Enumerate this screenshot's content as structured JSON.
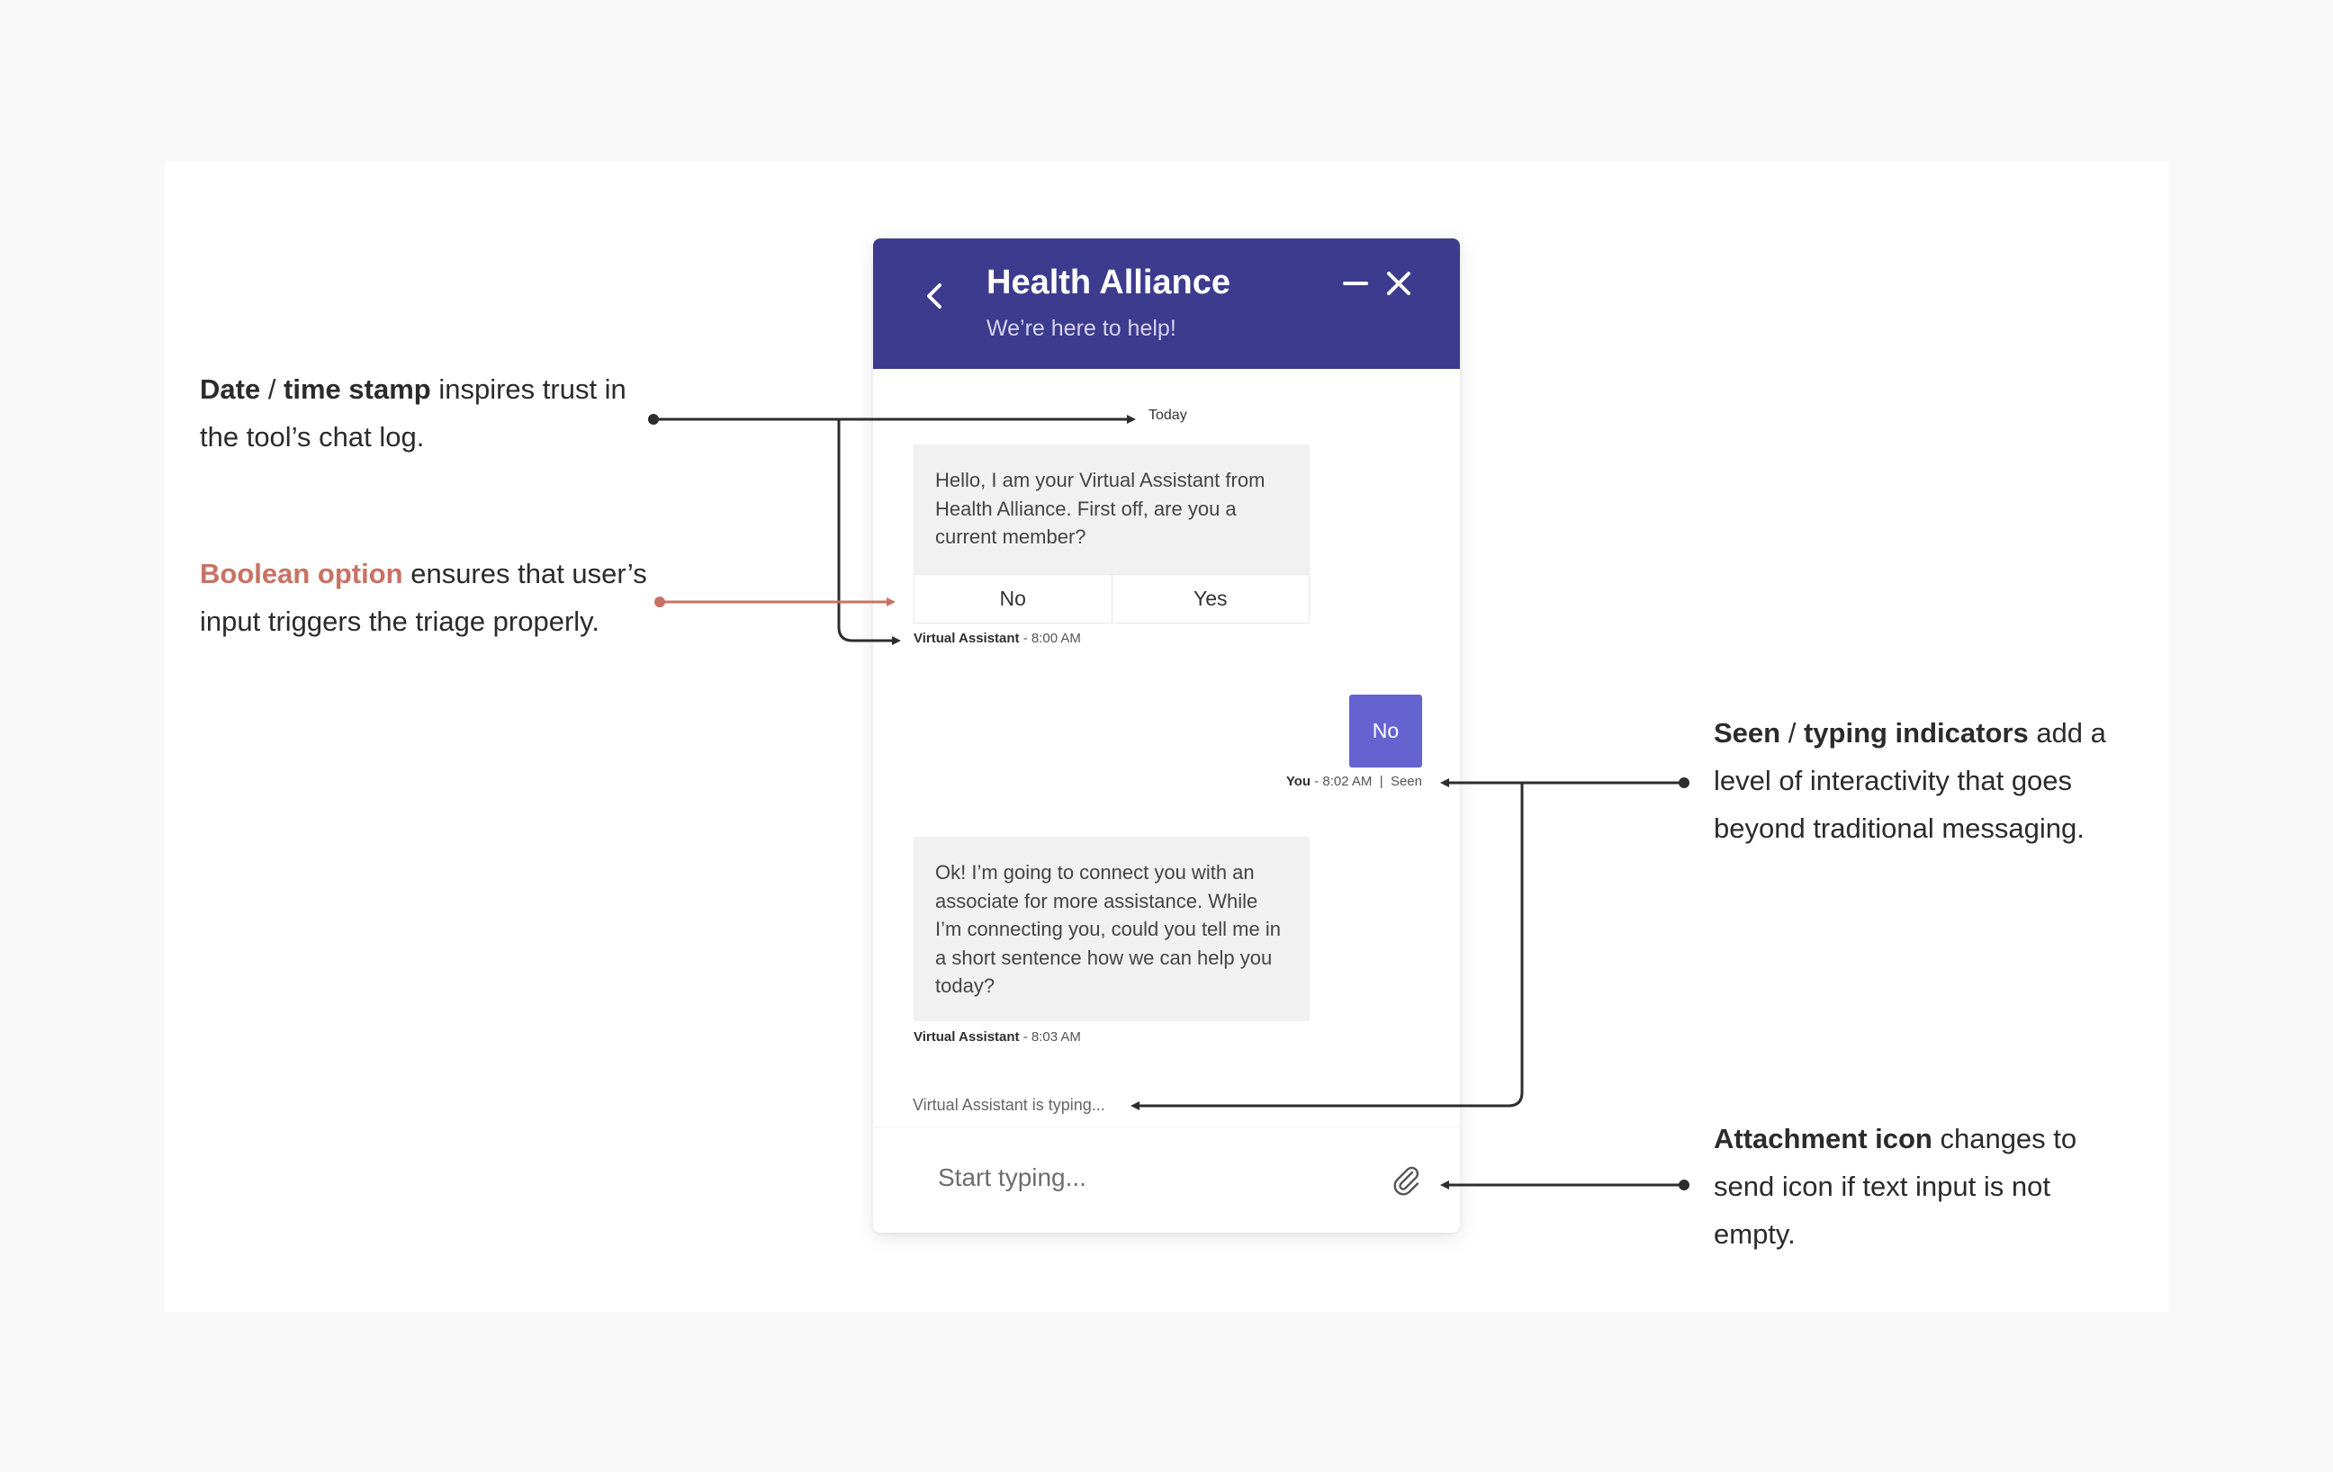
{
  "widget": {
    "title": "Health Alliance",
    "subtitle": "We’re here to help!",
    "header_color": "#3d3b8e",
    "icons": {
      "back": "chevron-left-icon",
      "minimize": "minimize-icon",
      "close": "close-icon",
      "attach": "paperclip-icon"
    }
  },
  "chat": {
    "date_label": "Today",
    "bot_message_1": "Hello, I am your Virtual Assistant from Health Alliance. First off, are you a current member?",
    "options": {
      "no": "No",
      "yes": "Yes"
    },
    "meta_1": {
      "sender": "Virtual Assistant",
      "time": " - 8:00 AM"
    },
    "user_message": "No",
    "meta_2": {
      "sender": "You",
      "time": " - 8:02 AM  |  Seen"
    },
    "bot_message_2": "Ok! I’m going to connect you with an associate for more assistance. While I’m connecting you, could you tell me in a short sentence how we can help you today?",
    "meta_3": {
      "sender": "Virtual Assistant",
      "time": " - 8:03 AM"
    },
    "typing": "Virtual Assistant is typing...",
    "input_placeholder": "Start typing...",
    "user_bubble_color": "#6563d0"
  },
  "annotations": {
    "timestamp": {
      "b1": "Date",
      "sep": " / ",
      "b2": "time stamp",
      "rest": " inspires trust in the tool’s chat log."
    },
    "boolean": {
      "accent": "Boolean option",
      "rest": " ensures that user’s input triggers the triage properly.",
      "accent_color": "#c97164"
    },
    "seen": {
      "b1": "Seen",
      "sep": " / ",
      "b2": "typing indicators",
      "rest": " add a level of interactivity that goes beyond traditional messaging."
    },
    "attachment": {
      "b1": "Attachment icon",
      "rest": " changes to send icon if text input is not empty."
    }
  }
}
